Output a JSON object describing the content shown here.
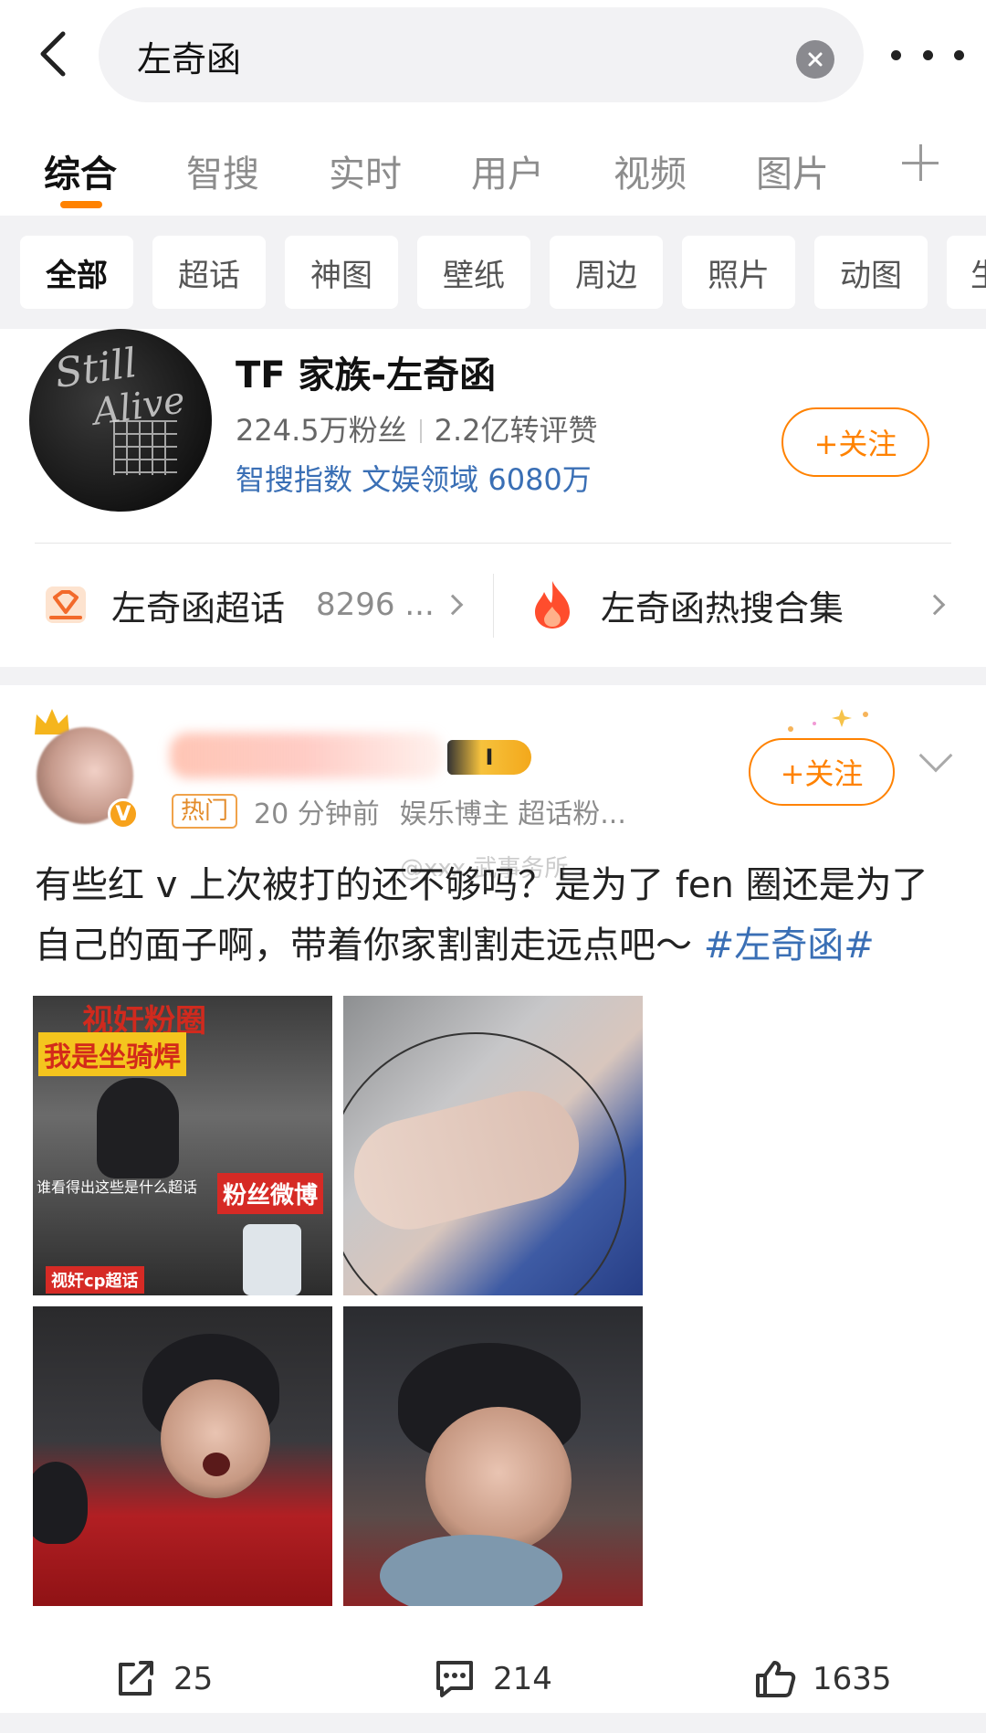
{
  "search": {
    "query": "左奇函"
  },
  "tabs": [
    "综合",
    "智搜",
    "实时",
    "用户",
    "视频",
    "图片"
  ],
  "chips": [
    "全部",
    "超话",
    "神图",
    "壁纸",
    "周边",
    "照片",
    "动图",
    "生"
  ],
  "profile": {
    "name": "TF 家族-左奇函",
    "fans": "224.5万粉丝",
    "interactions": "2.2亿转评赞",
    "index": "智搜指数 文娱领域 6080万",
    "follow_label": "+关注",
    "avatar_text_1": "Still",
    "avatar_text_2": "Alive",
    "supertopic_label": "左奇函超话",
    "supertopic_count": "8296 ...",
    "hotsearch_label": "左奇函热搜合集"
  },
  "post": {
    "level_badge": "I",
    "hot_badge": "热门",
    "time": "20 分钟前",
    "source": "娱乐博主 超话粉...",
    "follow_label": "+关注",
    "watermark": "@xxx 武事务所",
    "text_line1": "有些红 v 上次被打的还不够吗？是为了 fen 圈还是为了",
    "text_line2": "自己的面子啊，带着你家割割走远点吧～ ",
    "hashtag": "#左奇函#",
    "image1_captions": [
      "视奸粉圈",
      "我是坐骑焊",
      "粉丝微博",
      "谁看得出这些是什么超话",
      "视奸cp超话"
    ],
    "reposts": "25",
    "comments": "214",
    "likes": "1635"
  }
}
